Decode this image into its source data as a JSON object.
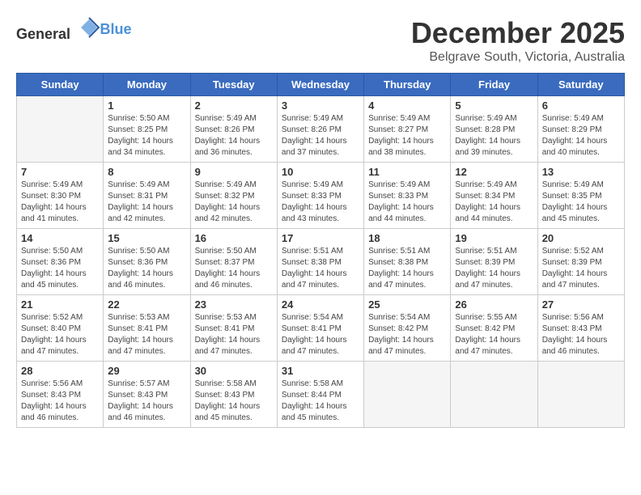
{
  "header": {
    "logo_general": "General",
    "logo_blue": "Blue",
    "title": "December 2025",
    "subtitle": "Belgrave South, Victoria, Australia"
  },
  "weekdays": [
    "Sunday",
    "Monday",
    "Tuesday",
    "Wednesday",
    "Thursday",
    "Friday",
    "Saturday"
  ],
  "weeks": [
    [
      {
        "day": "",
        "info": ""
      },
      {
        "day": "1",
        "info": "Sunrise: 5:50 AM\nSunset: 8:25 PM\nDaylight: 14 hours\nand 34 minutes."
      },
      {
        "day": "2",
        "info": "Sunrise: 5:49 AM\nSunset: 8:26 PM\nDaylight: 14 hours\nand 36 minutes."
      },
      {
        "day": "3",
        "info": "Sunrise: 5:49 AM\nSunset: 8:26 PM\nDaylight: 14 hours\nand 37 minutes."
      },
      {
        "day": "4",
        "info": "Sunrise: 5:49 AM\nSunset: 8:27 PM\nDaylight: 14 hours\nand 38 minutes."
      },
      {
        "day": "5",
        "info": "Sunrise: 5:49 AM\nSunset: 8:28 PM\nDaylight: 14 hours\nand 39 minutes."
      },
      {
        "day": "6",
        "info": "Sunrise: 5:49 AM\nSunset: 8:29 PM\nDaylight: 14 hours\nand 40 minutes."
      }
    ],
    [
      {
        "day": "7",
        "info": "Sunrise: 5:49 AM\nSunset: 8:30 PM\nDaylight: 14 hours\nand 41 minutes."
      },
      {
        "day": "8",
        "info": "Sunrise: 5:49 AM\nSunset: 8:31 PM\nDaylight: 14 hours\nand 42 minutes."
      },
      {
        "day": "9",
        "info": "Sunrise: 5:49 AM\nSunset: 8:32 PM\nDaylight: 14 hours\nand 42 minutes."
      },
      {
        "day": "10",
        "info": "Sunrise: 5:49 AM\nSunset: 8:33 PM\nDaylight: 14 hours\nand 43 minutes."
      },
      {
        "day": "11",
        "info": "Sunrise: 5:49 AM\nSunset: 8:33 PM\nDaylight: 14 hours\nand 44 minutes."
      },
      {
        "day": "12",
        "info": "Sunrise: 5:49 AM\nSunset: 8:34 PM\nDaylight: 14 hours\nand 44 minutes."
      },
      {
        "day": "13",
        "info": "Sunrise: 5:49 AM\nSunset: 8:35 PM\nDaylight: 14 hours\nand 45 minutes."
      }
    ],
    [
      {
        "day": "14",
        "info": "Sunrise: 5:50 AM\nSunset: 8:36 PM\nDaylight: 14 hours\nand 45 minutes."
      },
      {
        "day": "15",
        "info": "Sunrise: 5:50 AM\nSunset: 8:36 PM\nDaylight: 14 hours\nand 46 minutes."
      },
      {
        "day": "16",
        "info": "Sunrise: 5:50 AM\nSunset: 8:37 PM\nDaylight: 14 hours\nand 46 minutes."
      },
      {
        "day": "17",
        "info": "Sunrise: 5:51 AM\nSunset: 8:38 PM\nDaylight: 14 hours\nand 47 minutes."
      },
      {
        "day": "18",
        "info": "Sunrise: 5:51 AM\nSunset: 8:38 PM\nDaylight: 14 hours\nand 47 minutes."
      },
      {
        "day": "19",
        "info": "Sunrise: 5:51 AM\nSunset: 8:39 PM\nDaylight: 14 hours\nand 47 minutes."
      },
      {
        "day": "20",
        "info": "Sunrise: 5:52 AM\nSunset: 8:39 PM\nDaylight: 14 hours\nand 47 minutes."
      }
    ],
    [
      {
        "day": "21",
        "info": "Sunrise: 5:52 AM\nSunset: 8:40 PM\nDaylight: 14 hours\nand 47 minutes."
      },
      {
        "day": "22",
        "info": "Sunrise: 5:53 AM\nSunset: 8:41 PM\nDaylight: 14 hours\nand 47 minutes."
      },
      {
        "day": "23",
        "info": "Sunrise: 5:53 AM\nSunset: 8:41 PM\nDaylight: 14 hours\nand 47 minutes."
      },
      {
        "day": "24",
        "info": "Sunrise: 5:54 AM\nSunset: 8:41 PM\nDaylight: 14 hours\nand 47 minutes."
      },
      {
        "day": "25",
        "info": "Sunrise: 5:54 AM\nSunset: 8:42 PM\nDaylight: 14 hours\nand 47 minutes."
      },
      {
        "day": "26",
        "info": "Sunrise: 5:55 AM\nSunset: 8:42 PM\nDaylight: 14 hours\nand 47 minutes."
      },
      {
        "day": "27",
        "info": "Sunrise: 5:56 AM\nSunset: 8:43 PM\nDaylight: 14 hours\nand 46 minutes."
      }
    ],
    [
      {
        "day": "28",
        "info": "Sunrise: 5:56 AM\nSunset: 8:43 PM\nDaylight: 14 hours\nand 46 minutes."
      },
      {
        "day": "29",
        "info": "Sunrise: 5:57 AM\nSunset: 8:43 PM\nDaylight: 14 hours\nand 46 minutes."
      },
      {
        "day": "30",
        "info": "Sunrise: 5:58 AM\nSunset: 8:43 PM\nDaylight: 14 hours\nand 45 minutes."
      },
      {
        "day": "31",
        "info": "Sunrise: 5:58 AM\nSunset: 8:44 PM\nDaylight: 14 hours\nand 45 minutes."
      },
      {
        "day": "",
        "info": ""
      },
      {
        "day": "",
        "info": ""
      },
      {
        "day": "",
        "info": ""
      }
    ]
  ]
}
